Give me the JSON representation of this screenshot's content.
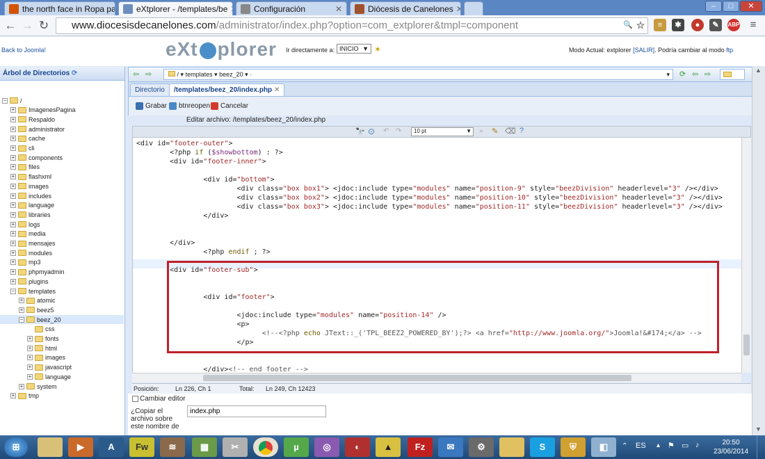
{
  "browser": {
    "tabs": [
      {
        "label": "the north face in Ropa par",
        "icon_color": "#d35400"
      },
      {
        "label": "eXtplorer - /templates/be",
        "icon_color": "#6d8fbf"
      },
      {
        "label": "Configuración",
        "icon_color": "#888888"
      },
      {
        "label": "Diócesis de Canelones",
        "icon_color": "#a0522d"
      }
    ],
    "url_host": "www.diocesisdecanelones.com",
    "url_path": "/administrator/index.php?option=com_extplorer&tmpl=component"
  },
  "app": {
    "back_link": "Back to Joomla!",
    "logo_left": "eXt",
    "logo_right": "plorer",
    "goto_label": "Ir directamente a:",
    "goto_value": "INICIO",
    "mode_text": "Modo Actual: extplorer",
    "mode_exit": "[SALIR]",
    "mode_change": "Podría cambiar al modo",
    "mode_ftp": "ftp"
  },
  "tree": {
    "title": "Árbol de Directorios",
    "root": "/",
    "items": [
      {
        "label": "ImagenesPagina",
        "level": 1
      },
      {
        "label": "Respaldo",
        "level": 1
      },
      {
        "label": "administrator",
        "level": 1
      },
      {
        "label": "cache",
        "level": 1
      },
      {
        "label": "cli",
        "level": 1
      },
      {
        "label": "components",
        "level": 1
      },
      {
        "label": "files",
        "level": 1
      },
      {
        "label": "flashxml",
        "level": 1
      },
      {
        "label": "images",
        "level": 1
      },
      {
        "label": "includes",
        "level": 1
      },
      {
        "label": "language",
        "level": 1
      },
      {
        "label": "libraries",
        "level": 1
      },
      {
        "label": "logs",
        "level": 1
      },
      {
        "label": "media",
        "level": 1
      },
      {
        "label": "mensajes",
        "level": 1
      },
      {
        "label": "modules",
        "level": 1
      },
      {
        "label": "mp3",
        "level": 1
      },
      {
        "label": "phpmyadmin",
        "level": 1
      },
      {
        "label": "plugins",
        "level": 1
      },
      {
        "label": "templates",
        "level": 1
      },
      {
        "label": "atomic",
        "level": 2
      },
      {
        "label": "beez5",
        "level": 2
      },
      {
        "label": "beez_20",
        "level": 2
      },
      {
        "label": "css",
        "level": 3
      },
      {
        "label": "fonts",
        "level": 3
      },
      {
        "label": "html",
        "level": 3
      },
      {
        "label": "images",
        "level": 3
      },
      {
        "label": "javascript",
        "level": 3
      },
      {
        "label": "language",
        "level": 3
      },
      {
        "label": "system",
        "level": 2
      },
      {
        "label": "tmp",
        "level": 1
      }
    ]
  },
  "pathbar": {
    "crumb1": "/",
    "crumb2": "templates",
    "crumb3": "beez_20"
  },
  "tabs": {
    "directory": "Directorio",
    "file": "/templates/beez_20/index.php"
  },
  "actions": {
    "save": "Grabar",
    "reopen": "btnreopen",
    "cancel": "Cancelar"
  },
  "editor": {
    "title": "Editar archivo: /templates/beez_20/index.php",
    "font_size": "10 pt",
    "position_label": "Posición:",
    "position_value": "Ln 226, Ch 1",
    "total_label": "Total:",
    "total_value": "Ln 249, Ch 12423",
    "change_editor": "Cambiar editor",
    "copy_label_1": "¿Copiar el",
    "copy_label_2": "archivo sobre",
    "copy_label_3": "este nombre de",
    "copy_value": "index.php"
  },
  "code_lines": [
    "<div id=\"footer-outer\">",
    "        <?php if ($showbottom) : ?>",
    "        <div id=\"footer-inner\">",
    "",
    "                <div id=\"bottom\">",
    "                        <div class=\"box box1\"> <jdoc:include type=\"modules\" name=\"position-9\" style=\"beezDivision\" headerlevel=\"3\" /></div>",
    "                        <div class=\"box box2\"> <jdoc:include type=\"modules\" name=\"position-10\" style=\"beezDivision\" headerlevel=\"3\" /></div>",
    "                        <div class=\"box box3\"> <jdoc:include type=\"modules\" name=\"position-11\" style=\"beezDivision\" headerlevel=\"3\" /></div>",
    "                </div>",
    "",
    "",
    "        </div>",
    "                <?php endif ; ?>",
    "",
    "        <div id=\"footer-sub\">",
    "",
    "",
    "                <div id=\"footer\">",
    "",
    "                        <jdoc:include type=\"modules\" name=\"position-14\" />",
    "                        <p>",
    "                              <!--<?php echo JText::_('TPL_BEEZ2_POWERED_BY');?> <a href=\"http://www.joomla.org/\">Joomla!&#174;</a> -->",
    "                        </p>",
    "",
    "",
    "                </div><!-- end footer -->"
  ],
  "taskbar": {
    "language": "ES",
    "time": "20:50",
    "date": "23/06/2014"
  },
  "colors": {
    "highlight_box": "#c0202a",
    "accent": "#15428b"
  }
}
